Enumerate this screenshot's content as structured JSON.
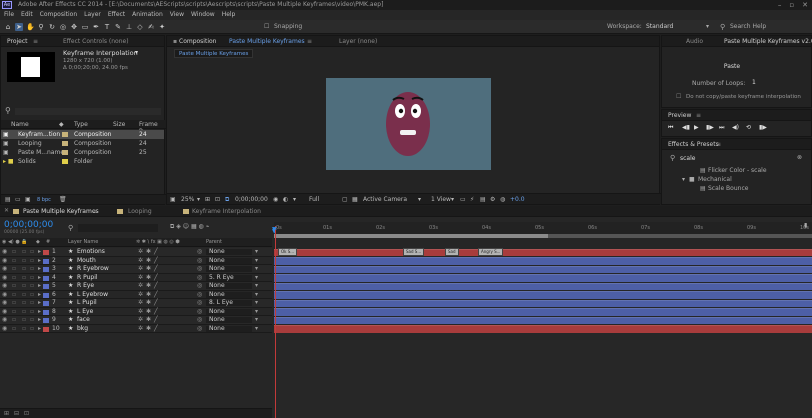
{
  "app": {
    "title": "Adobe After Effects CC 2014 - [E:\\Documents\\AEScripts\\scripts\\Aescripts\\scripts\\Paste Multiple Keyframes\\video\\PMK.aep]",
    "logo": "Ae"
  },
  "menu": [
    "File",
    "Edit",
    "Composition",
    "Layer",
    "Effect",
    "Animation",
    "View",
    "Window",
    "Help"
  ],
  "toolbar": {
    "snapping_label": "Snapping",
    "workspace_label": "Workspace:",
    "workspace_value": "Standard",
    "search_placeholder": "Search Help"
  },
  "project_panel": {
    "tabs": [
      "Project",
      "Effect Controls (none)"
    ],
    "selected_name": "Keyframe Interpolation",
    "selected_info_1": "1280 x 720 (1.00)",
    "selected_info_2": "Δ 0;00;20;00, 24.00 fps",
    "search_icon": "search-icon",
    "columns": [
      "Name",
      "Type",
      "Size",
      "Frame R..."
    ],
    "items": [
      {
        "name": "Keyfram...tion",
        "type": "Composition",
        "size": "",
        "rate": "24",
        "color": "#c7b37a",
        "selected": true
      },
      {
        "name": "Looping",
        "type": "Composition",
        "size": "",
        "rate": "24",
        "color": "#c7b37a",
        "selected": false
      },
      {
        "name": "Paste M...names",
        "type": "Composition",
        "size": "",
        "rate": "25",
        "color": "#c7b37a",
        "selected": false
      },
      {
        "name": "Solids",
        "type": "Folder",
        "size": "",
        "rate": "",
        "color": "#e0cf4a",
        "selected": false
      }
    ],
    "bpc": "8 bpc"
  },
  "comp_panel": {
    "tab_label": "Composition",
    "tab_comp": "Paste Multiple Keyframes",
    "layer_tab": "Layer (none)",
    "subtab": "Paste Multiple Keyframes",
    "zoom": "25%",
    "timecode": "0;00;00;00",
    "resolution": "Full",
    "camera": "Active Camera",
    "views": "1 View",
    "exposure": "+0.0"
  },
  "script_panel": {
    "tab_audio": "Audio",
    "tab_title": "Paste Multiple Keyframes v2.0",
    "paste_button": "Paste",
    "loops_label": "Number of Loops:",
    "loops_value": "1",
    "checkbox_label": "Do not copy/paste keyframe interpolation"
  },
  "preview_panel": {
    "tab": "Preview"
  },
  "effects_panel": {
    "tab": "Effects & Presets",
    "search_value": "scale",
    "items": [
      {
        "label": "Flicker Color - scale",
        "indent": 2
      },
      {
        "label": "Mechanical",
        "indent": 1
      },
      {
        "label": "Scale Bounce",
        "indent": 2
      }
    ]
  },
  "timeline": {
    "tabs": [
      "Paste Multiple Keyframes",
      "Looping",
      "Keyframe Interpolation"
    ],
    "timecode": "0;00;00;00",
    "timecode_sub": "00000 (25.00 fps)",
    "col_layer_name": "Layer Name",
    "col_parent": "Parent",
    "ruler": [
      "0s",
      "01s",
      "02s",
      "03s",
      "04s",
      "05s",
      "06s",
      "07s",
      "08s",
      "09s",
      "10s"
    ],
    "work_area_end_fraction": 0.51,
    "layers": [
      {
        "num": "1",
        "name": "Emotions",
        "parent": "None",
        "color": "#c04848"
      },
      {
        "num": "2",
        "name": "Mouth",
        "parent": "None",
        "color": "#5a6ec8"
      },
      {
        "num": "3",
        "name": "R Eyebrow",
        "parent": "None",
        "color": "#5a6ec8"
      },
      {
        "num": "4",
        "name": "R Pupil",
        "parent": "5. R Eye",
        "color": "#5a6ec8"
      },
      {
        "num": "5",
        "name": "R Eye",
        "parent": "None",
        "color": "#5a6ec8"
      },
      {
        "num": "6",
        "name": "L Eyebrow",
        "parent": "None",
        "color": "#5a6ec8"
      },
      {
        "num": "7",
        "name": "L Pupil",
        "parent": "8. L Eye",
        "color": "#5a6ec8"
      },
      {
        "num": "8",
        "name": "L Eye",
        "parent": "None",
        "color": "#5a6ec8"
      },
      {
        "num": "9",
        "name": "face",
        "parent": "None",
        "color": "#5a6ec8"
      },
      {
        "num": "10",
        "name": "bkg",
        "parent": "None",
        "color": "#c04848"
      }
    ],
    "markers": [
      "Ok S...",
      "Sad S...",
      "Sad",
      "Angry S..."
    ]
  },
  "colors": {
    "accent": "#2d8ceb",
    "comp_bg": "#4f6e7d",
    "face": "#7a2f4c",
    "layer_red": "#a83c3c",
    "layer_blue": "#4d5fa6"
  }
}
